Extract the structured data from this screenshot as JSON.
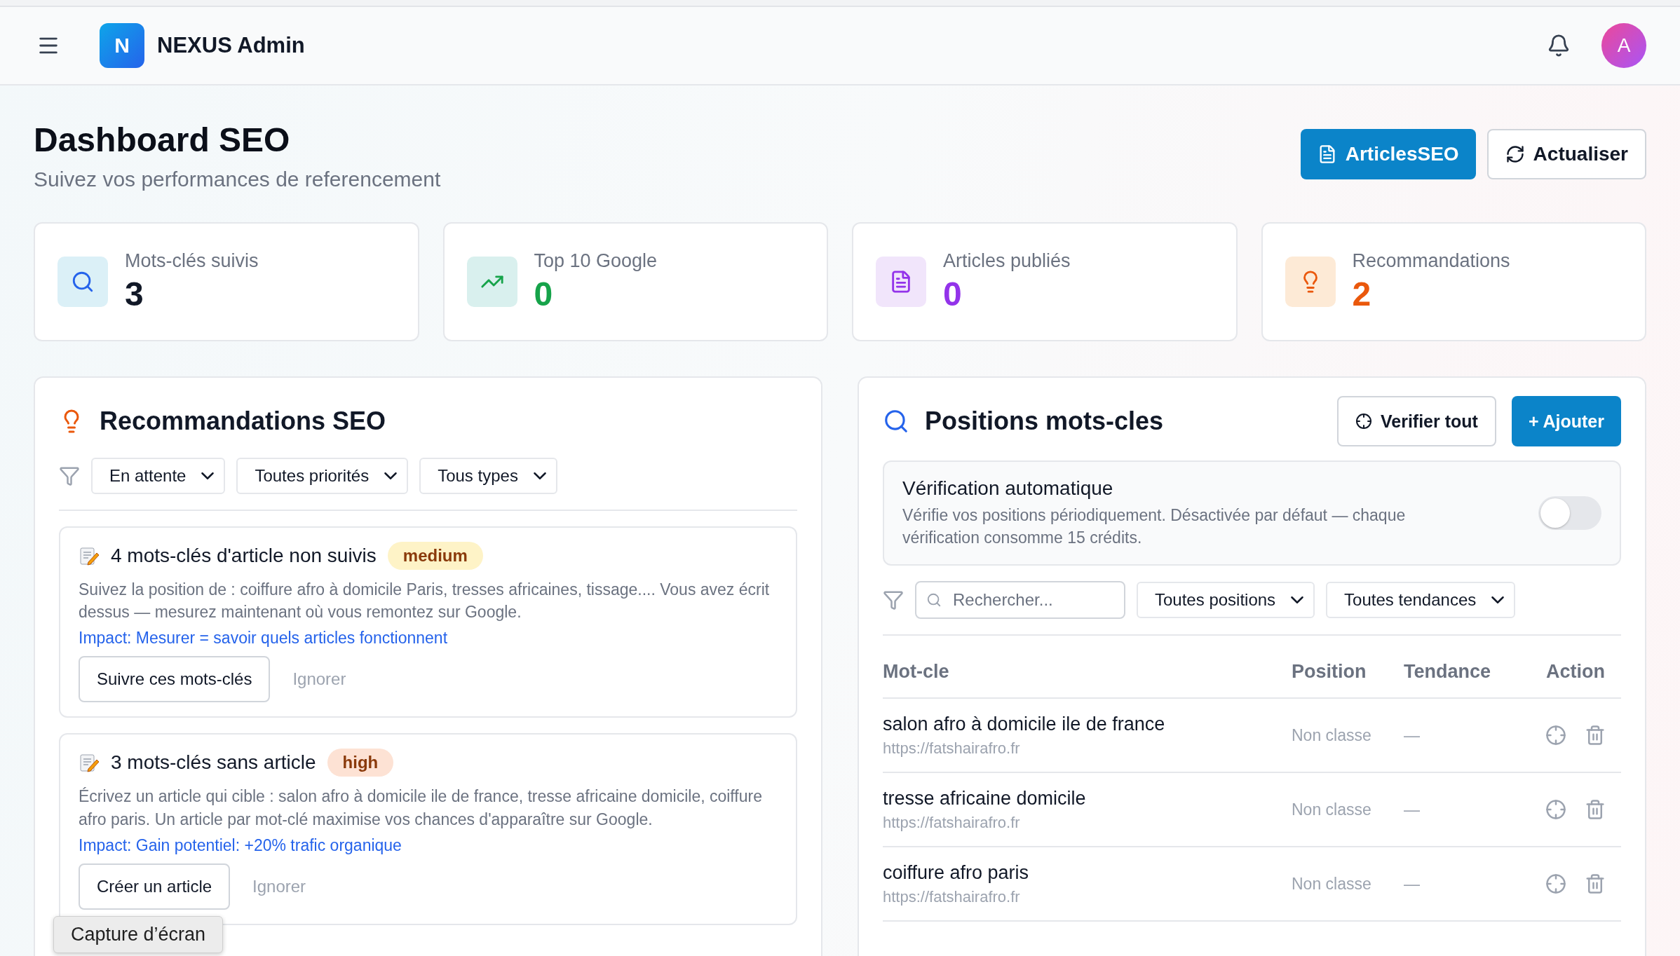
{
  "header": {
    "logo_letter": "N",
    "app_name": "NEXUS Admin",
    "avatar_letter": "A"
  },
  "page": {
    "title": "Dashboard SEO",
    "subtitle": "Suivez vos performances de referencement",
    "buttons": [
      {
        "label": "ArticlesSEO",
        "kind": "primary"
      },
      {
        "label": "Actualiser",
        "kind": "secondary"
      }
    ]
  },
  "stats": [
    {
      "label": "Mots-clés suivis",
      "value": "3",
      "kind": "search",
      "color": "#111827"
    },
    {
      "label": "Top 10 Google",
      "value": "0",
      "kind": "trend",
      "color": "#16a34a"
    },
    {
      "label": "Articles publiés",
      "value": "0",
      "kind": "article",
      "color": "#9333ea"
    },
    {
      "label": "Recommandations",
      "value": "2",
      "kind": "idea",
      "color": "#ea580c"
    }
  ],
  "recommendations": {
    "title": "Recommandations SEO",
    "filters": [
      "En attente",
      "Toutes priorités",
      "Tous types"
    ],
    "items": [
      {
        "title": "4 mots-clés d'article non suivis",
        "badge": {
          "label": "medium",
          "color": "#fef3c7"
        },
        "description": "Suivez la position de : coiffure afro à domicile Paris, tresses africaines, tissage.... Vous avez écrit dessus — mesurez maintenant où vous remontez sur Google.",
        "impact": "Impact: Mesurer = savoir quels articles fonctionnent",
        "action": "Suivre ces mots-clés",
        "dismiss": "Ignorer"
      },
      {
        "title": "3 mots-clés sans article",
        "badge": {
          "label": "high",
          "color": "#fde2d4"
        },
        "description": "Écrivez un article qui cible : salon afro à domicile ile de france, tresse africaine domicile, coiffure afro paris. Un article par mot-clé maximise vos chances d'apparaître sur Google.",
        "impact": "Impact: Gain potentiel: +20% trafic organique",
        "action": "Créer un article",
        "dismiss": "Ignorer"
      }
    ]
  },
  "positions": {
    "title": "Positions mots-cles",
    "buttons": [
      {
        "label": "Verifier tout",
        "kind": "secondary"
      },
      {
        "label": "+ Ajouter",
        "kind": "primary"
      }
    ],
    "auto_check": {
      "title": "Vérification automatique",
      "description": "Vérifie vos positions périodiquement. Désactivée par défaut — chaque vérification consomme 15 crédits.",
      "on": false
    },
    "search": {
      "placeholder": "Rechercher..."
    },
    "filters": [
      "Toutes positions",
      "Toutes tendances"
    ],
    "table": {
      "columns": [
        "Mot-cle",
        "Position",
        "Tendance",
        "Action"
      ],
      "rows": [
        {
          "keyword": "salon afro à domicile ile de france",
          "url": "https://fatshairafro.fr",
          "position": "Non classe",
          "trend": "—"
        },
        {
          "keyword": "tresse africaine domicile",
          "url": "https://fatshairafro.fr",
          "position": "Non classe",
          "trend": "—"
        },
        {
          "keyword": "coiffure afro paris",
          "url": "https://fatshairafro.fr",
          "position": "Non classe",
          "trend": "—"
        }
      ]
    }
  },
  "tooltip": {
    "text": "Capture d’écran"
  }
}
